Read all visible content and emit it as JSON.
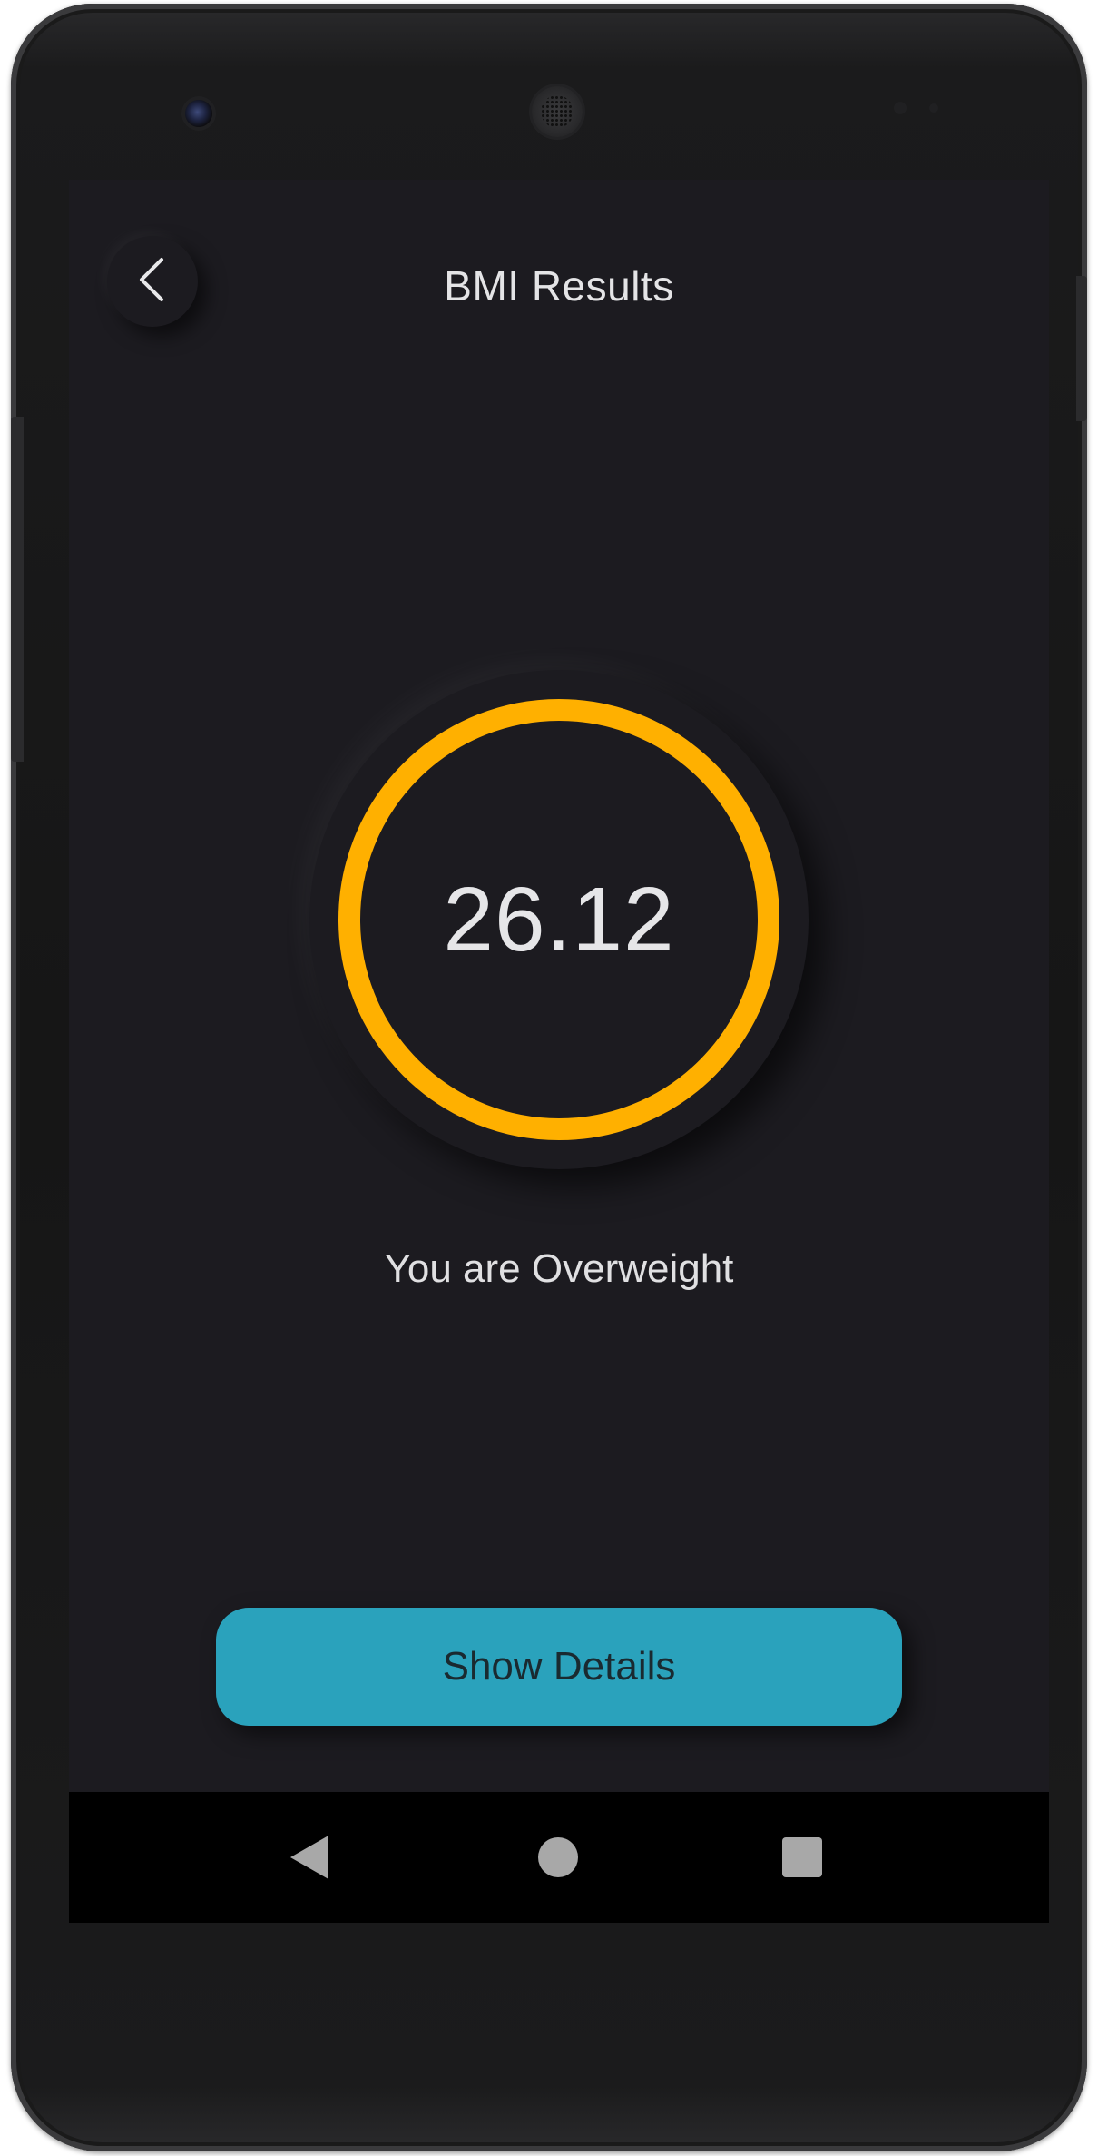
{
  "header": {
    "title": "BMI Results",
    "back_icon": "chevron-left-icon"
  },
  "result": {
    "bmi_value": "26.12",
    "status_text": "You are Overweight",
    "ring_color": "#ffb000"
  },
  "actions": {
    "show_details_label": "Show Details",
    "button_color": "#2aa2bc"
  },
  "system_nav": {
    "back_icon": "nav-back-triangle-icon",
    "home_icon": "nav-home-circle-icon",
    "recents_icon": "nav-recents-square-icon"
  },
  "theme": {
    "background": "#1c1b20",
    "text": "#e4e4e6"
  }
}
